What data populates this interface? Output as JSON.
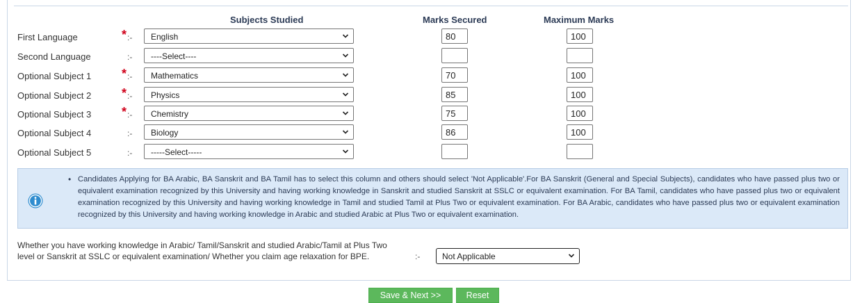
{
  "headers": {
    "subjects": "Subjects Studied",
    "marks": "Marks Secured",
    "maximum": "Maximum Marks"
  },
  "colon_text": ":-",
  "required_mark": "*",
  "rows": [
    {
      "label": "First Language",
      "required": true,
      "subject": "English",
      "marks": "80",
      "max": "100"
    },
    {
      "label": "Second Language",
      "required": false,
      "subject": "----Select----",
      "marks": "",
      "max": ""
    },
    {
      "label": "Optional Subject 1",
      "required": true,
      "subject": "Mathematics",
      "marks": "70",
      "max": "100"
    },
    {
      "label": "Optional Subject 2",
      "required": true,
      "subject": "Physics",
      "marks": "85",
      "max": "100"
    },
    {
      "label": "Optional Subject 3",
      "required": true,
      "subject": "Chemistry",
      "marks": "75",
      "max": "100"
    },
    {
      "label": "Optional Subject 4",
      "required": false,
      "subject": "Biology",
      "marks": "86",
      "max": "100"
    },
    {
      "label": "Optional Subject 5",
      "required": false,
      "subject": "-----Select-----",
      "marks": "",
      "max": ""
    }
  ],
  "info": {
    "text": "Candidates Applying for BA Arabic, BA Sanskrit and BA Tamil has to select this column and others should select 'Not Applicable'.For BA Sanskrit (General and Special Subjects), candidates who have passed plus two or equivalent examination recognized by this University and having working knowledge in Sanskrit and studied Sanskrit at SSLC or equivalent examination. For BA Tamil, candidates who have passed plus two or equivalent examination recognized by this University and having working knowledge in Tamil and studied Tamil at Plus Two or equivalent examination. For BA Arabic, candidates who have passed plus two or equivalent examination recognized by this University and having working knowledge in Arabic and studied Arabic at Plus Two or equivalent examination."
  },
  "question": {
    "text": "Whether you have working knowledge in Arabic/ Tamil/Sanskrit and studied Arabic/Tamil at Plus Two level or Sanskrit at SSLC or equivalent examination/ Whether you claim age relaxation for BPE.",
    "colon": ":-",
    "selected": "Not Applicable"
  },
  "buttons": {
    "save": "Save & Next >>",
    "reset": "Reset"
  },
  "colors": {
    "required": "#d0021b",
    "info_bg": "#dbe9f8",
    "info_icon": "#2e8ccf",
    "button": "#5cb85c"
  }
}
